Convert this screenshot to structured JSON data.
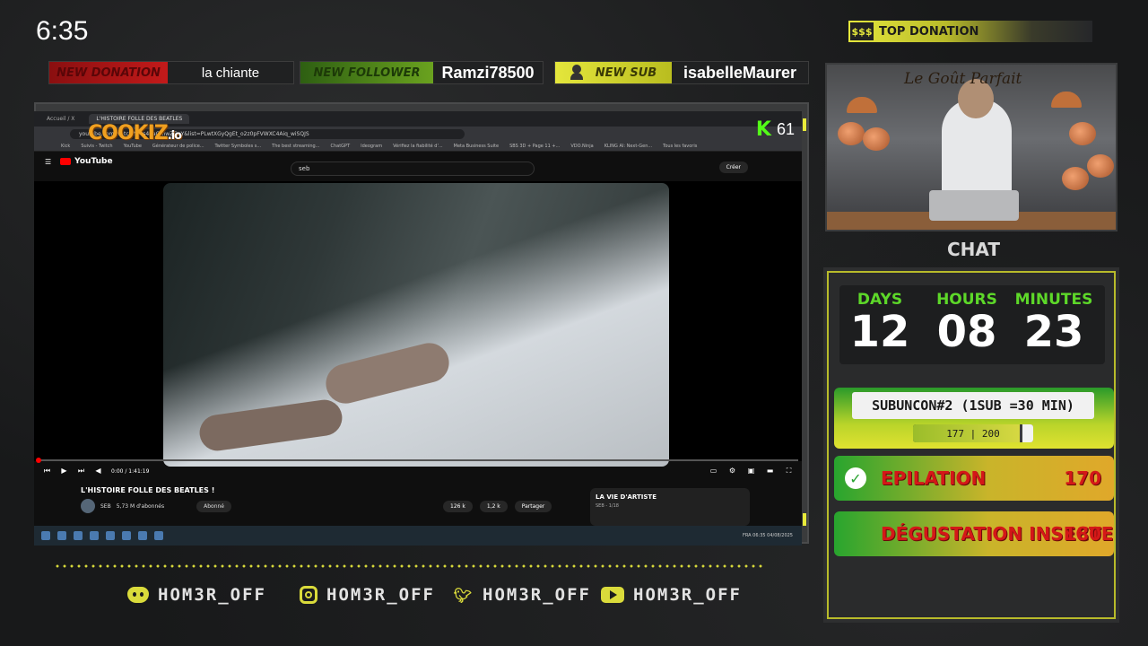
{
  "clock": "6:35",
  "alerts": {
    "donation": {
      "tag": "NEW DONATION",
      "value": "la chiante"
    },
    "follower": {
      "tag": "NEW FOLLOWER",
      "value": "Ramzi78500"
    },
    "sub": {
      "tag": "NEW SUB",
      "value": "isabelleMaurer"
    }
  },
  "top_donation": {
    "icon_text": "$$$",
    "label": "TOP DONATION"
  },
  "browser": {
    "tabs": [
      "Accueil / X",
      "L'HISTOIRE FOLLE DES BEATLES"
    ],
    "url": "youtube.com/watch?v=s4naOmwZGeY&list=PLwtXGyQgEt_o2z0pFVWXC4Aiq_wiSQJS",
    "bookmarks": [
      "Kick",
      "Suivis - Twitch",
      "YouTube",
      "Générateur de police...",
      "Twitter Symboles s...",
      "The best streaming...",
      "ChatGPT",
      "Ideogram",
      "Vérifiez la fiabilité d'...",
      "Meta Business Suite",
      "SBS 3D + Page 11 +...",
      "VDO.Ninja",
      "KLING AI: Next-Gen...",
      "Tous les favoris"
    ]
  },
  "cookiz": {
    "main": "COOKIZ",
    "tld": ".io"
  },
  "kick": {
    "letter": "K",
    "count": "61"
  },
  "youtube": {
    "logo": "YouTube",
    "search": "seb",
    "create": "Créer",
    "time": "0:00 / 1:41:19",
    "title": "L'HISTOIRE FOLLE DES BEATLES !",
    "channel": "SEB",
    "subs": "5,73 M d'abonnés",
    "subscribe": "Abonné",
    "likes": "126 k",
    "dislikes": "1,2 k",
    "share": "Partager",
    "playlist_title": "LA VIE D'ARTISTE",
    "playlist_sub": "SEB - 1/18"
  },
  "taskbar": {
    "lang": "FRA",
    "time": "06:35",
    "date": "04/08/2025"
  },
  "chef": {
    "title": "Le Goût Parfait"
  },
  "chat_label": "CHAT",
  "timer": {
    "days_label": "DAYS",
    "days": "12",
    "hours_label": "HOURS",
    "hours": "08",
    "minutes_label": "MINUTES",
    "minutes": "23"
  },
  "subathon": {
    "title": "SUBUNCON#2 (1SUB =30 MIN)",
    "current": "177",
    "target": "200",
    "progress_text": "177 | 200",
    "progress_fraction": 0.885
  },
  "goals": [
    {
      "name": "EPILATION",
      "points": "170",
      "done": true
    },
    {
      "name": "DÉGUSTATION INSECTE",
      "points": "180",
      "done": false
    }
  ],
  "socials": {
    "discord": "HOM3R_OFF",
    "instagram": "HOM3R_OFF",
    "twitter": "HOM3R_OFF",
    "youtube": "HOM3R_OFF"
  },
  "colors": {
    "accent_yellow": "#dadb3b",
    "timer_green": "#5dd829",
    "goal_red": "#d41818"
  }
}
